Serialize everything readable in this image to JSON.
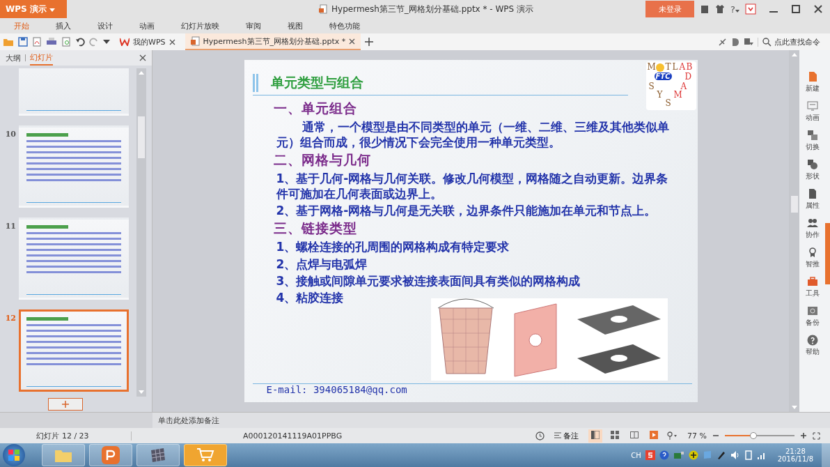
{
  "window": {
    "app_button": "WPS 演示",
    "title": "Hypermesh第三节_网格划分基础.pptx * - WPS 演示",
    "login_button": "未登录",
    "help": "?"
  },
  "menu": [
    {
      "label": "开始",
      "selected": true
    },
    {
      "label": "插入",
      "selected": false
    },
    {
      "label": "设计",
      "selected": false
    },
    {
      "label": "动画",
      "selected": false
    },
    {
      "label": "幻灯片放映",
      "selected": false
    },
    {
      "label": "审阅",
      "selected": false
    },
    {
      "label": "视图",
      "selected": false
    },
    {
      "label": "特色功能",
      "selected": false
    }
  ],
  "doc_tabs": [
    {
      "label": "我的WPS",
      "selected": false
    },
    {
      "label": "Hypermesh第三节_网格划分基础.pptx *",
      "selected": true
    }
  ],
  "search": {
    "placeholder": "点此查找命令"
  },
  "panel": {
    "tabs": [
      {
        "label": "大纲",
        "selected": false
      },
      {
        "label": "幻灯片",
        "selected": true
      }
    ],
    "thumbnails": [
      {
        "selected": false
      },
      {
        "number": "10",
        "selected": false
      },
      {
        "number": "11",
        "selected": false
      },
      {
        "number": "12",
        "selected": true
      }
    ]
  },
  "slide": {
    "title": "单元类型与组合",
    "logo": {
      "top": [
        "M",
        "T",
        "L",
        "A",
        "B"
      ],
      "badge": "FTC",
      "bottom": [
        "D",
        "S",
        "A",
        "Y",
        "M",
        "S"
      ]
    },
    "sections": [
      {
        "heading": "一、单元组合",
        "paragraphs": [
          "通常，一个模型是由不同类型的单元（一维、二维、三维及其他类似单元）组合而成，很少情况下会完全使用一种单元类型。"
        ],
        "indent": true
      },
      {
        "heading": "二、网格与几何",
        "paragraphs": [
          "1、基于几何-网格与几何关联。修改几何模型，网格随之自动更新。边界条件可施加在几何表面或边界上。",
          "2、基于网格-网格与几何是无关联，边界条件只能施加在单元和节点上。"
        ],
        "indent": false
      },
      {
        "heading": "三、链接类型",
        "paragraphs": [
          "1、螺栓连接的孔周围的网格构成有特定要求",
          "2、点焊与电弧焊",
          "3、接触或间隙单元要求被连接表面间具有类似的网格构成",
          "4、粘胶连接"
        ],
        "indent": false
      }
    ],
    "footer": "E-mail: 394065184@qq.com"
  },
  "sidebar": [
    {
      "label": "新建",
      "kind": "new"
    },
    {
      "label": "动画",
      "kind": "animation"
    },
    {
      "label": "切换",
      "kind": "transition"
    },
    {
      "label": "形状",
      "kind": "shape"
    },
    {
      "label": "属性",
      "kind": "property"
    },
    {
      "label": "协作",
      "kind": "people"
    },
    {
      "label": "智推",
      "kind": "award"
    },
    {
      "label": "工具",
      "kind": "toolbox"
    },
    {
      "label": "备份",
      "kind": "backup"
    },
    {
      "label": "帮助",
      "kind": "help"
    }
  ],
  "notes": {
    "placeholder": "单击此处添加备注"
  },
  "status_bar": {
    "slide": "幻灯片 12 / 23",
    "template": "A000120141119A01PPBG",
    "notes_button": "备注",
    "views": [
      {
        "kind": "normal",
        "selected": true
      },
      {
        "kind": "sorter",
        "selected": false
      },
      {
        "kind": "reading",
        "selected": false
      },
      {
        "kind": "show",
        "selected": false
      }
    ],
    "zoom": "77 %",
    "zoom_level": {
      "level": 0.45
    }
  },
  "taskbar": {
    "apps": [
      {
        "kind": "folder",
        "selected": false
      },
      {
        "kind": "wps",
        "selected": false
      },
      {
        "kind": "grid",
        "selected": false
      },
      {
        "kind": "cart",
        "selected": true
      }
    ],
    "lang": "CH",
    "time": "21:28",
    "date": "2016/11/8"
  }
}
